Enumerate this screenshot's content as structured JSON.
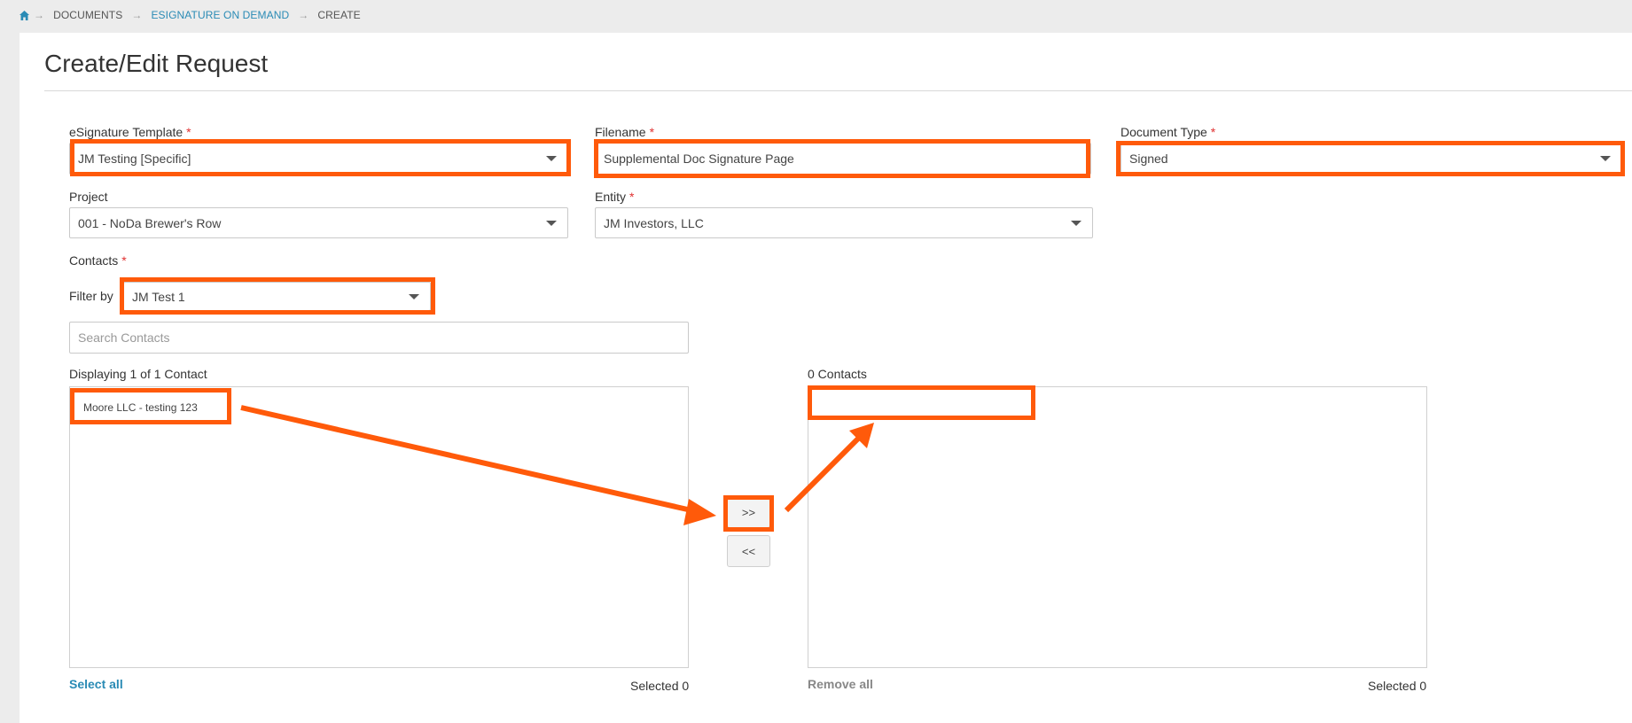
{
  "breadcrumb": {
    "items": [
      "DOCUMENTS",
      "ESIGNATURE ON DEMAND",
      "CREATE"
    ]
  },
  "page": {
    "title": "Create/Edit Request"
  },
  "form": {
    "template": {
      "label": "eSignature Template",
      "required": "*",
      "value": "JM Testing [Specific]"
    },
    "filename": {
      "label": "Filename",
      "required": "*",
      "value": "Supplemental Doc Signature Page"
    },
    "document_type": {
      "label": "Document Type",
      "required": "*",
      "value": "Signed"
    },
    "project": {
      "label": "Project",
      "value": "001 - NoDa Brewer's Row"
    },
    "entity": {
      "label": "Entity",
      "required": "*",
      "value": "JM Investors, LLC"
    },
    "contacts": {
      "label": "Contacts",
      "required": "*",
      "filter_label": "Filter by",
      "filter_value": "JM Test 1",
      "search_placeholder": "Search Contacts"
    }
  },
  "available": {
    "header": "Displaying 1 of 1 Contact",
    "items": [
      "Moore LLC - testing 123"
    ],
    "select_all": "Select all",
    "selected": "Selected 0"
  },
  "selected_list": {
    "header": "0 Contacts",
    "remove_all": "Remove all",
    "selected": "Selected 0"
  },
  "buttons": {
    "add": ">>",
    "remove": "<<"
  },
  "colors": {
    "highlight": "#ff5a0a",
    "link": "#2a8bb5",
    "required": "#e03030"
  },
  "icons": {
    "home": "home-icon",
    "separator": "arrow-right-icon",
    "dropdown": "caret-down-icon"
  }
}
